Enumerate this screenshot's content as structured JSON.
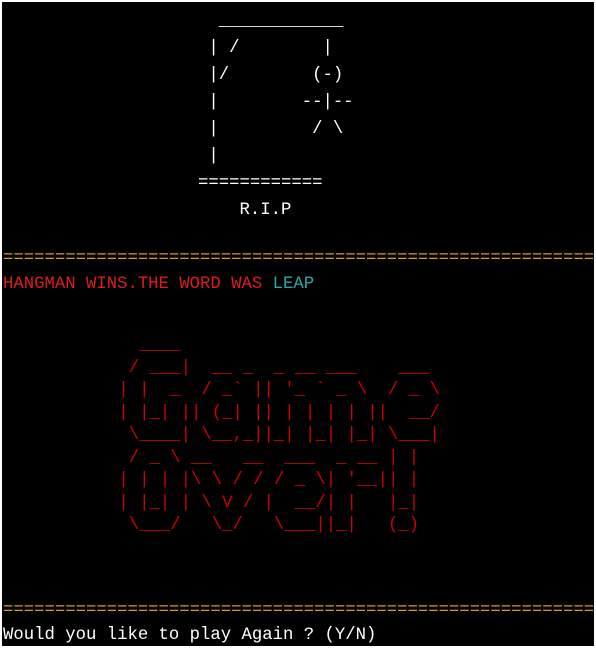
{
  "gallows_art": "  ____________\n | /        |\n |/        (-)\n |        --|--\n |         / \\\n |\n============\n    R.I.P",
  "divider": "==============================================================================",
  "result": {
    "message": "HANGMAN WINS.THE WORD WAS ",
    "word": "LEAP"
  },
  "game_over_art": "   ____\n  / ___|  __ _  _ __ ___    ___\n | |  _  / _` || '_ ` _ \\  / _ \\\n | |_| || (_| || | | | | ||  __/\n  \\____| \\__,_||_| |_| |_| \\___|\n  / _ \\ __   __  ___  _ __ | |\n | | | |\\ \\ / / / _ \\| '__|| |\n | |_| | \\ V / |  __/| |   |_|\n  \\___/   \\_/   \\___||_|   (_)",
  "prompt": "Would you like to play Again ? (Y/N)",
  "colors": {
    "background": "#000000",
    "text": "#ffffff",
    "divider": "#d4a017",
    "message": "#e01b1b",
    "word": "#2aa7a7",
    "art": "#cc0000"
  }
}
